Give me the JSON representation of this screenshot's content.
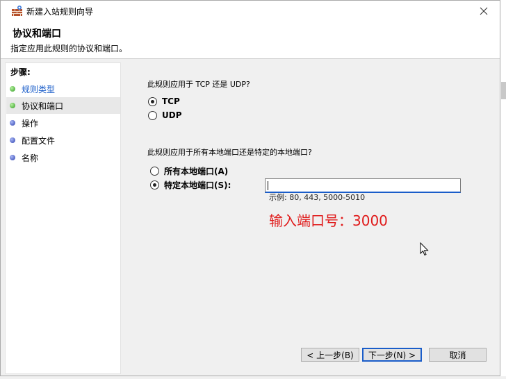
{
  "window": {
    "title": "新建入站规则向导"
  },
  "header": {
    "title": "协议和端口",
    "subtitle": "指定应用此规则的协议和端口。"
  },
  "steps": {
    "label": "步骤:",
    "items": [
      {
        "label": "规则类型",
        "state": "done"
      },
      {
        "label": "协议和端口",
        "state": "current"
      },
      {
        "label": "操作",
        "state": "pending"
      },
      {
        "label": "配置文件",
        "state": "pending"
      },
      {
        "label": "名称",
        "state": "pending"
      }
    ]
  },
  "protocol": {
    "question": "此规则应用于 TCP 还是 UDP?",
    "options": [
      {
        "label": "TCP",
        "checked": true
      },
      {
        "label": "UDP",
        "checked": false
      }
    ]
  },
  "ports": {
    "question": "此规则应用于所有本地端口还是特定的本地端口?",
    "options": [
      {
        "label": "所有本地端口(A)",
        "checked": false
      },
      {
        "label": "特定本地端口(S):",
        "checked": true
      }
    ],
    "input_value": "",
    "example": "示例: 80, 443, 5000-5010"
  },
  "annotation": "输入端口号：3000",
  "buttons": {
    "back": "< 上一步(B)",
    "next": "下一步(N) >",
    "cancel": "取消"
  },
  "colors": {
    "accent": "#1a5dc9",
    "annotation": "#e01b1b",
    "step_done": "#2e9b1f",
    "step_pending": "#2b3fae"
  },
  "icons": {
    "app": "firewall-wall-icon",
    "close": "close-icon",
    "cursor": "mouse-pointer-icon"
  }
}
